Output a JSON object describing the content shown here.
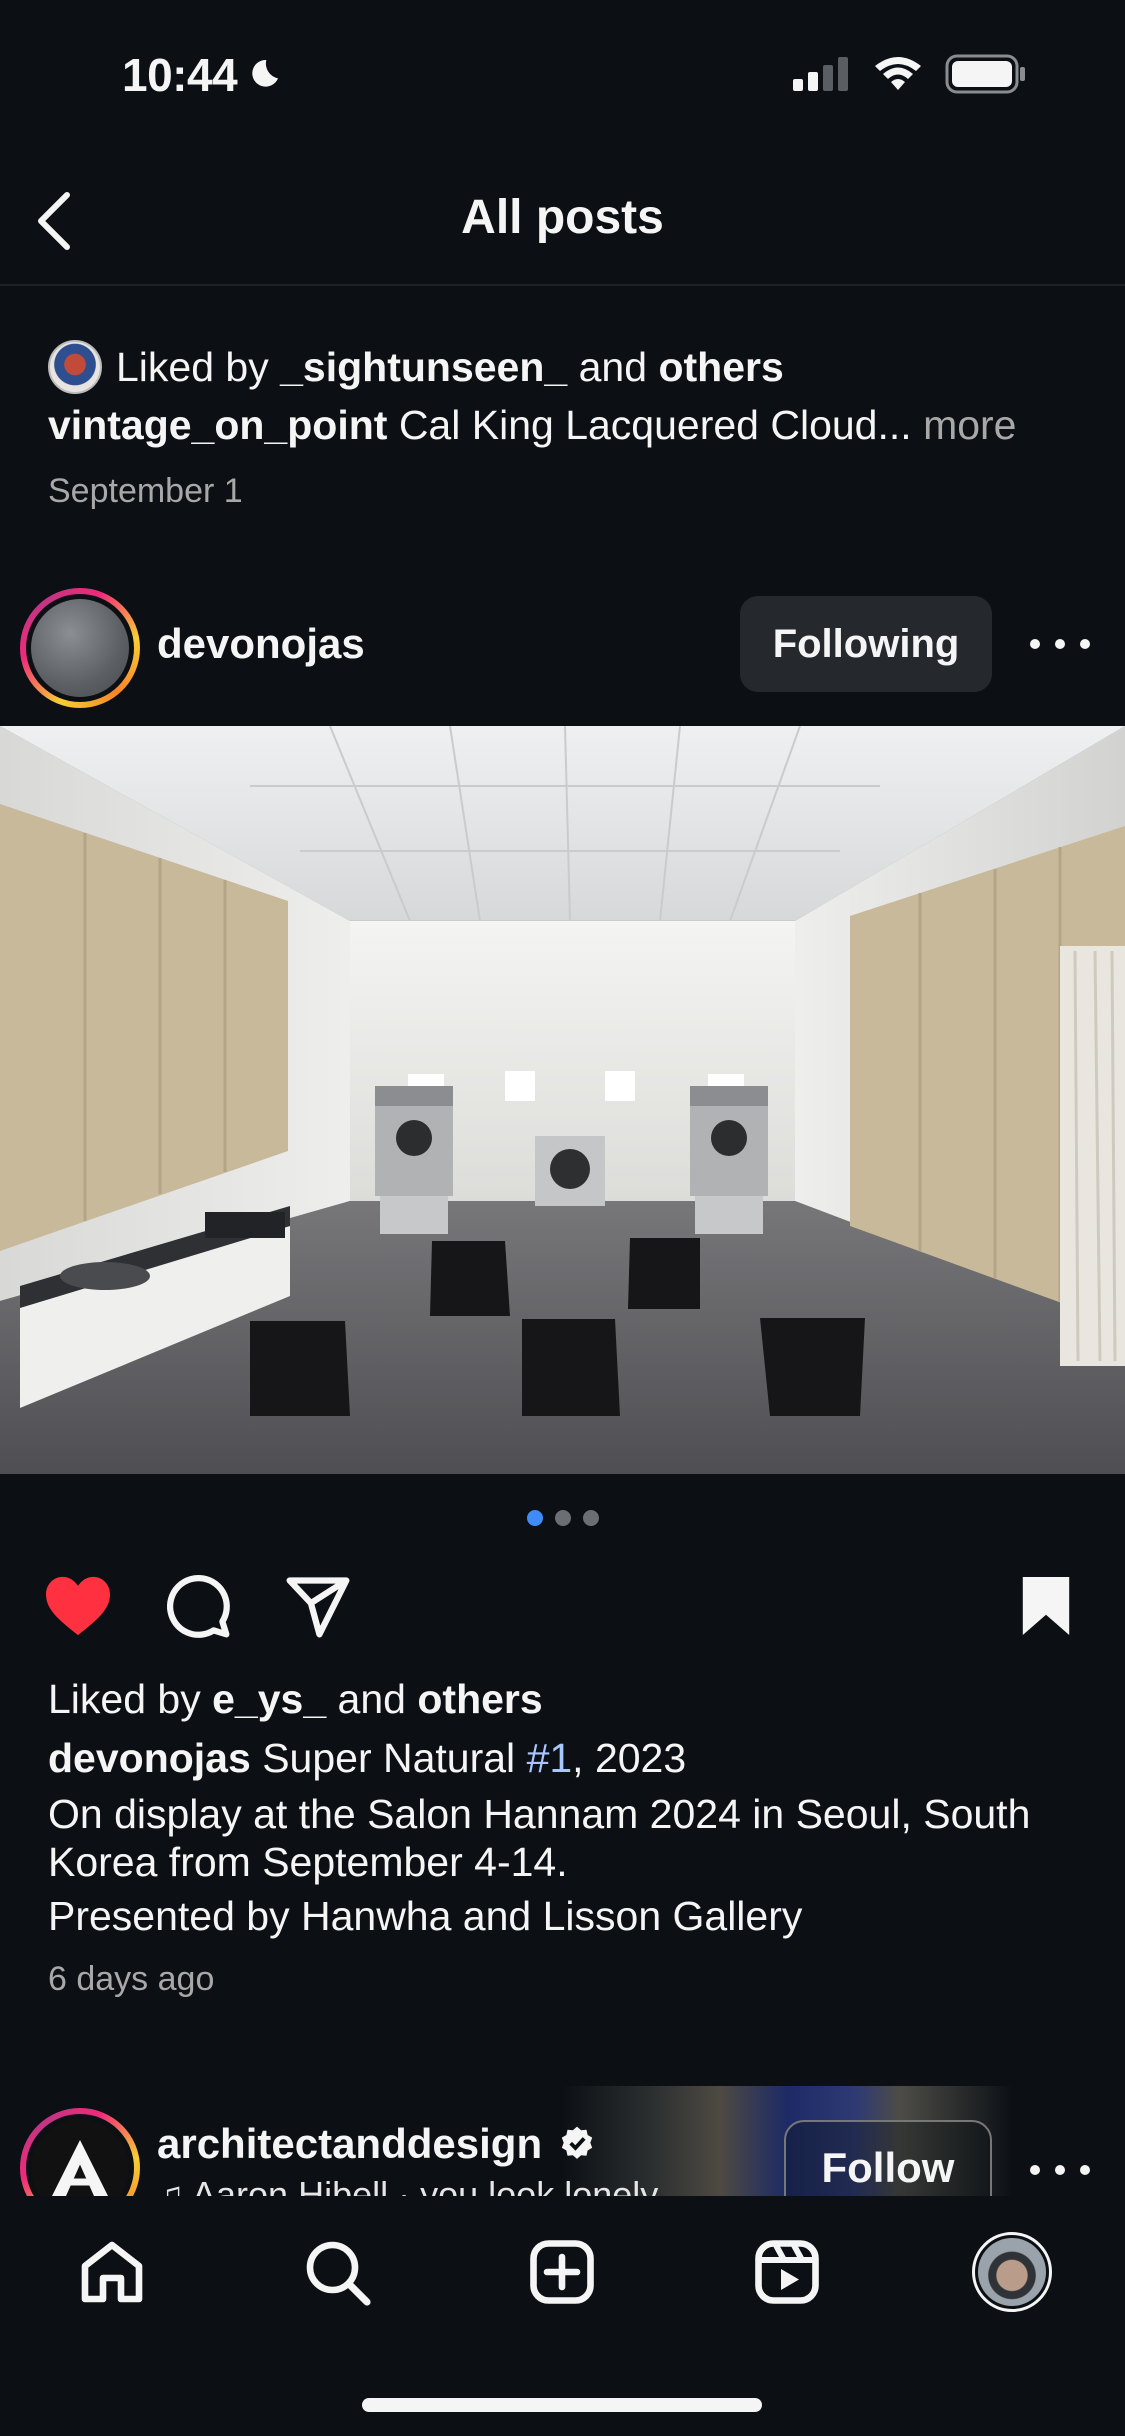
{
  "status": {
    "time": "10:44"
  },
  "header": {
    "title": "All posts"
  },
  "previous_post": {
    "liked_prefix": "Liked by",
    "liked_user": "_sightunseen_",
    "liked_and": "and",
    "liked_others": "others",
    "caption_user": "vintage_on_point",
    "caption_text": "Cal King Lacquered Cloud...",
    "caption_more": "more",
    "date": "September 1"
  },
  "post": {
    "username": "devonojas",
    "follow_state": "Following",
    "carousel_count": 3,
    "carousel_active_index": 0,
    "liked": true,
    "saved": true,
    "liked_prefix": "Liked by",
    "liked_user": "e_ys_",
    "liked_and": "and",
    "liked_others": "others",
    "caption_user": "devonojas",
    "caption_title_pre": "Super Natural",
    "caption_tag": "#1",
    "caption_title_post": ", 2023",
    "caption_line2": "On display at the Salon Hannam 2024 in Seoul, South Korea from September 4-14.",
    "caption_line3": "Presented by Hanwha and Lisson Gallery",
    "time_ago": "6 days ago"
  },
  "next_post": {
    "username": "architectanddesign",
    "verified": true,
    "song": "Aaron Hibell · you look lonely",
    "follow_label": "Follow"
  },
  "tabbar": {
    "items": [
      "home-icon",
      "search-icon",
      "create-icon",
      "reels-icon",
      "profile-avatar"
    ]
  },
  "colors": {
    "background": "#0c1014",
    "like_red": "#ff3040",
    "link_blue": "#a9c6ff",
    "dot_active": "#3f8bf7"
  }
}
